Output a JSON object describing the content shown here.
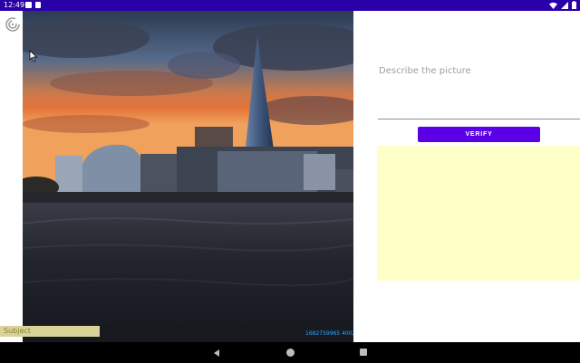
{
  "status_bar": {
    "time": "12:49",
    "notification_icons": [
      "app-notification-icon",
      "sd-card-icon"
    ],
    "system_icons": [
      "wifi-icon",
      "cellular-icon",
      "battery-icon"
    ]
  },
  "photo": {
    "description_alt": "",
    "id_text": "1682759965 4002 7440 0"
  },
  "subject_label": "Subject",
  "panel": {
    "prompt": "Describe the picture",
    "verify_label": "VERIFY"
  },
  "colors": {
    "status_bar": "#2a00a8",
    "accent": "#5b00e6",
    "result_bg": "#ffffc8"
  }
}
